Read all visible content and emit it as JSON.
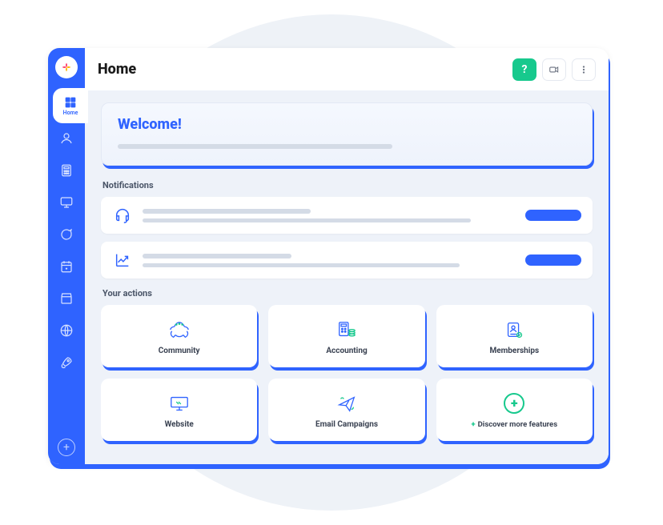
{
  "colors": {
    "primary": "#2f63ff",
    "accent": "#17c98d",
    "bg": "#eef2f9"
  },
  "header": {
    "title": "Home",
    "help_label": "?",
    "video_icon": "video-icon",
    "more_icon": "more-vertical-icon"
  },
  "sidebar": {
    "active": {
      "label": "Home",
      "icon": "grid-icon"
    },
    "items": [
      {
        "icon": "user-icon"
      },
      {
        "icon": "calculator-icon"
      },
      {
        "icon": "monitor-icon"
      },
      {
        "icon": "chat-icon"
      },
      {
        "icon": "calendar-icon"
      },
      {
        "icon": "store-icon"
      },
      {
        "icon": "globe-icon"
      },
      {
        "icon": "rocket-icon"
      }
    ],
    "add_icon": "plus-icon"
  },
  "welcome": {
    "title": "Welcome!"
  },
  "notifications": {
    "heading": "Notifications",
    "items": [
      {
        "icon": "headset-icon"
      },
      {
        "icon": "chart-up-icon"
      }
    ]
  },
  "actions": {
    "heading": "Your actions",
    "cards": [
      {
        "label": "Community",
        "icon": "community-icon"
      },
      {
        "label": "Accounting",
        "icon": "accounting-icon"
      },
      {
        "label": "Memberships",
        "icon": "memberships-icon"
      },
      {
        "label": "Website",
        "icon": "website-icon"
      },
      {
        "label": "Email Campaigns",
        "icon": "paper-plane-icon"
      },
      {
        "label": "Discover more features",
        "icon": "discover-plus-icon",
        "is_discover": true
      }
    ]
  }
}
